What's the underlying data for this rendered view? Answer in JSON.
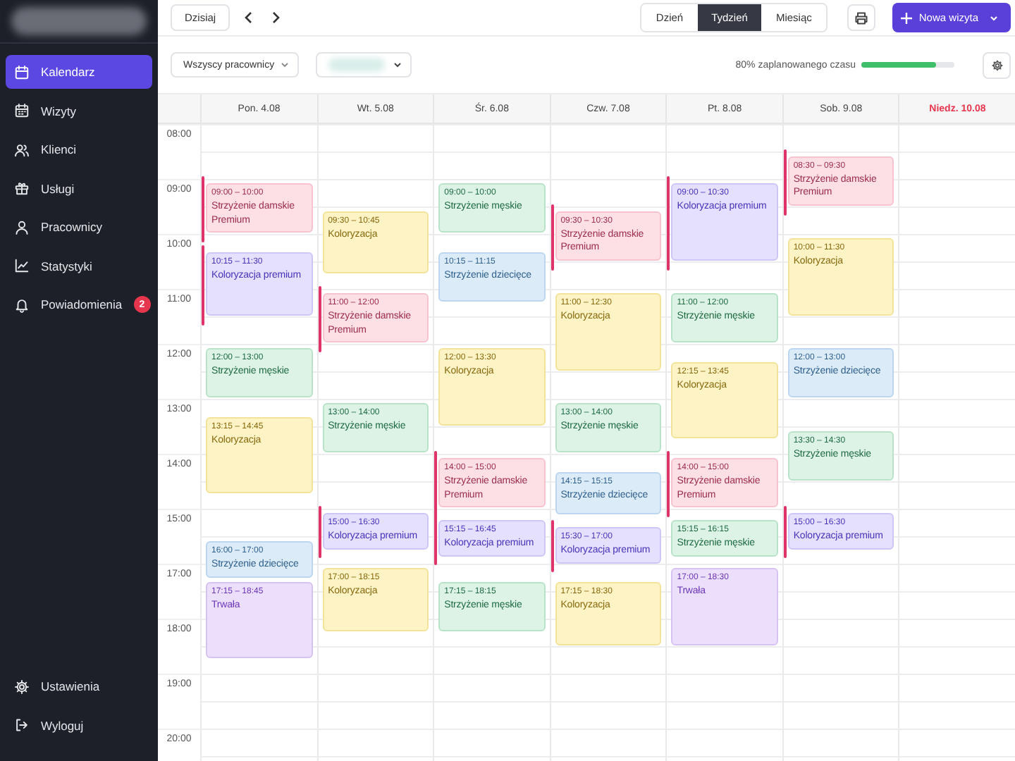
{
  "sidebar": {
    "items": [
      {
        "label": "Kalendarz",
        "selected": true
      },
      {
        "label": "Wizyty",
        "selected": false
      },
      {
        "label": "Klienci",
        "selected": false
      },
      {
        "label": "Usługi",
        "selected": false
      },
      {
        "label": "Pracownicy",
        "selected": false
      },
      {
        "label": "Statystyki",
        "selected": false
      },
      {
        "label": "Powiadomienia",
        "selected": false,
        "badge": "2"
      }
    ],
    "bottom_items": [
      {
        "label": "Ustawienia"
      },
      {
        "label": "Wyloguj"
      }
    ]
  },
  "toolbar": {
    "today": "Dzisiaj",
    "views": [
      {
        "label": "Dzień",
        "selected": false
      },
      {
        "label": "Tydzień",
        "selected": true
      },
      {
        "label": "Miesiąc",
        "selected": false
      }
    ],
    "new_button": "Nowa wizyta"
  },
  "filters": {
    "staff": "Wszyscy pracownicy",
    "utilization": {
      "label": "80% zaplanowanego czasu",
      "level": 0.8
    }
  },
  "times": [
    "08:00",
    "09:00",
    "10:00",
    "11:00",
    "12:00",
    "13:00",
    "14:00",
    "15:00",
    "17:00",
    "18:00",
    "19:00",
    "20:00"
  ],
  "days": [
    {
      "label": "Pon. 4.08",
      "highlighted": false,
      "events": [
        {
          "time": "09:00 – 10:00",
          "title": "Strzyżenie damskie Premium",
          "kind": "women",
          "marked": true
        },
        {
          "time": "10:15 – 11:30",
          "title": "Koloryzacja premium",
          "kind": "color_premium",
          "marked": true
        },
        {
          "time": "12:00 – 13:00",
          "title": "Strzyżenie męskie",
          "kind": "men",
          "marked": false
        },
        {
          "time": "13:15 – 14:45",
          "title": "Koloryzacja",
          "kind": "color",
          "marked": false
        },
        {
          "time": "16:00 – 17:00",
          "title": "Strzyżenie dziecięce",
          "kind": "kids",
          "marked": false
        },
        {
          "time": "17:15 – 18:45",
          "title": "Trwała",
          "kind": "perm",
          "marked": false
        }
      ]
    },
    {
      "label": "Wt. 5.08",
      "highlighted": false,
      "events": [
        {
          "time": "09:30 – 10:45",
          "title": "Koloryzacja",
          "kind": "color",
          "marked": false
        },
        {
          "time": "11:00 – 12:00",
          "title": "Strzyżenie damskie Premium",
          "kind": "women",
          "marked": true
        },
        {
          "time": "13:00 – 14:00",
          "title": "Strzyżenie męskie",
          "kind": "men",
          "marked": false
        },
        {
          "time": "15:00 – 16:30",
          "title": "Koloryzacja premium",
          "kind": "color_premium",
          "marked": true
        },
        {
          "time": "17:00 – 18:15",
          "title": "Koloryzacja",
          "kind": "color",
          "marked": false
        }
      ]
    },
    {
      "label": "Śr. 6.08",
      "highlighted": false,
      "events": [
        {
          "time": "09:00 – 10:00",
          "title": "Strzyżenie męskie",
          "kind": "men",
          "marked": false
        },
        {
          "time": "10:15 – 11:15",
          "title": "Strzyżenie dziecięce",
          "kind": "kids",
          "marked": false
        },
        {
          "time": "12:00 – 13:30",
          "title": "Koloryzacja",
          "kind": "color",
          "marked": false
        },
        {
          "time": "14:00 – 15:00",
          "title": "Strzyżenie damskie Premium",
          "kind": "women",
          "marked": true
        },
        {
          "time": "15:15 – 16:45",
          "title": "Koloryzacja premium",
          "kind": "color_premium",
          "marked": true
        },
        {
          "time": "17:15 – 18:15",
          "title": "Strzyżenie męskie",
          "kind": "men",
          "marked": false
        }
      ]
    },
    {
      "label": "Czw. 7.08",
      "highlighted": false,
      "events": [
        {
          "time": "09:30 – 10:30",
          "title": "Strzyżenie damskie Premium",
          "kind": "women",
          "marked": true
        },
        {
          "time": "11:00 – 12:30",
          "title": "Koloryzacja",
          "kind": "color",
          "marked": false
        },
        {
          "time": "13:00 – 14:00",
          "title": "Strzyżenie męskie",
          "kind": "men",
          "marked": false
        },
        {
          "time": "14:15 – 15:15",
          "title": "Strzyżenie dziecięce",
          "kind": "kids",
          "marked": false
        },
        {
          "time": "15:30 – 17:00",
          "title": "Koloryzacja premium",
          "kind": "color_premium",
          "marked": true
        },
        {
          "time": "17:15 – 18:30",
          "title": "Koloryzacja",
          "kind": "color",
          "marked": false
        }
      ]
    },
    {
      "label": "Pt. 8.08",
      "highlighted": false,
      "events": [
        {
          "time": "09:00 – 10:30",
          "title": "Koloryzacja premium",
          "kind": "color_premium",
          "marked": true
        },
        {
          "time": "11:00 – 12:00",
          "title": "Strzyżenie męskie",
          "kind": "men",
          "marked": false
        },
        {
          "time": "12:15 – 13:45",
          "title": "Koloryzacja",
          "kind": "color",
          "marked": false
        },
        {
          "time": "14:00 – 15:00",
          "title": "Strzyżenie damskie Premium",
          "kind": "women",
          "marked": true
        },
        {
          "time": "15:15 – 16:15",
          "title": "Strzyżenie męskie",
          "kind": "men",
          "marked": false
        },
        {
          "time": "17:00 – 18:30",
          "title": "Trwała",
          "kind": "perm",
          "marked": false
        }
      ]
    },
    {
      "label": "Sob. 9.08",
      "highlighted": false,
      "events": [
        {
          "time": "08:30 – 09:30",
          "title": "Strzyżenie damskie Premium",
          "kind": "women",
          "marked": true
        },
        {
          "time": "10:00 – 11:30",
          "title": "Koloryzacja",
          "kind": "color",
          "marked": false
        },
        {
          "time": "12:00 – 13:00",
          "title": "Strzyżenie dziecięce",
          "kind": "kids",
          "marked": false
        },
        {
          "time": "13:30 – 14:30",
          "title": "Strzyżenie męskie",
          "kind": "men",
          "marked": false
        },
        {
          "time": "15:00 – 16:30",
          "title": "Koloryzacja premium",
          "kind": "color_premium",
          "marked": true
        }
      ]
    },
    {
      "label": "Niedz. 10.08",
      "highlighted": true
    }
  ]
}
